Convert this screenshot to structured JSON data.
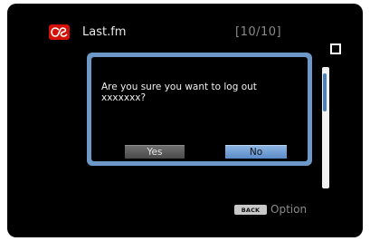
{
  "header": {
    "app_name": "Last.fm",
    "page_indicator": "[10/10]",
    "logo_icon": "lastfm-logo-icon",
    "logo_mark": "as"
  },
  "dialog": {
    "message": "Are you sure you want to log out\nxxxxxxx?",
    "yes_label": "Yes",
    "no_label": "No",
    "selected_button": "No"
  },
  "footer": {
    "back_key_label": "BACK",
    "option_label": "Option"
  },
  "scrollbar": {
    "position_fraction": 0.08
  },
  "colors": {
    "background": "#000000",
    "dialog_frame": "#6d98c8",
    "selected_button": "#7aa6dc",
    "brand": "#d51007"
  }
}
